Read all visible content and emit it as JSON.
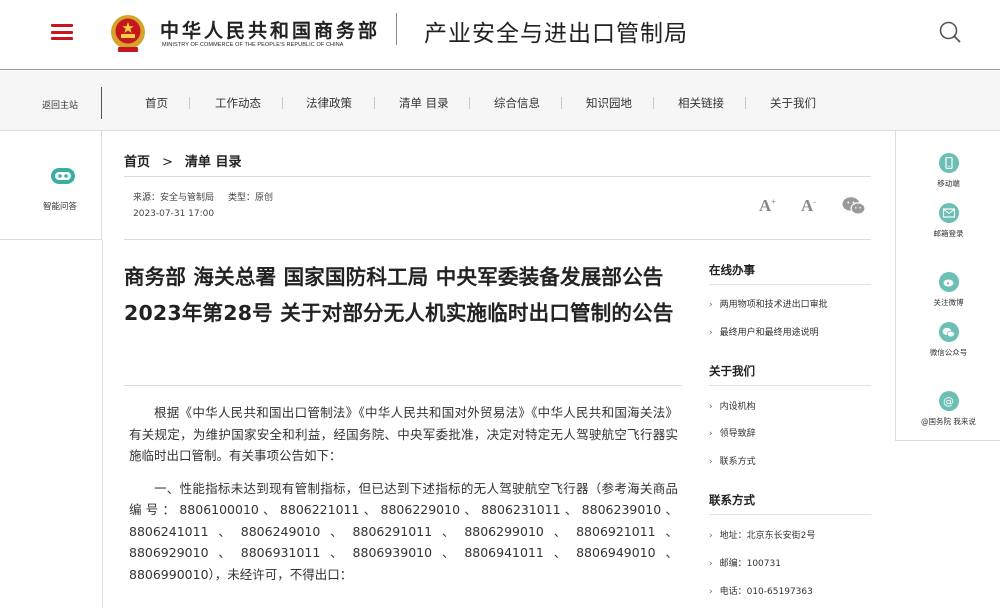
{
  "header": {
    "ministry_cn": "中华人民共和国商务部",
    "ministry_en": "MINISTRY OF COMMERCE OF THE PEOPLE'S REPUBLIC OF CHINA",
    "bureau": "产业安全与进出口管制局",
    "brand_color": "#c8161d"
  },
  "nav": {
    "home": "返回主站",
    "items": [
      "首页",
      "工作动态",
      "法律政策",
      "清单 目录",
      "综合信息",
      "知识园地",
      "相关链接",
      "关于我们"
    ]
  },
  "left_panel": {
    "label": "智能问答",
    "icon": "robot-icon"
  },
  "right_panel": {
    "items": [
      {
        "label": "移动端",
        "icon": "mobile-icon"
      },
      {
        "label": "邮箱登录",
        "icon": "mail-icon"
      },
      {
        "label": "关注微博",
        "icon": "weibo-icon"
      },
      {
        "label": "微信公众号",
        "icon": "wechat-icon"
      },
      {
        "label": "@国务院 我来说",
        "icon": "at-icon"
      }
    ],
    "accent": "#6cbfb4"
  },
  "breadcrumb": {
    "home": "首页",
    "sep": ">",
    "current": "清单 目录"
  },
  "meta": {
    "source_label": "来源：",
    "source": "安全与管制局",
    "type_label": "类型：",
    "type": "原创",
    "date": "2023-07-31 17:00",
    "font_large": "A",
    "font_small": "A",
    "font_large_sup": "+",
    "font_small_sup": "-"
  },
  "article": {
    "title": "商务部 海关总署 国家国防科工局 中央军委装备发展部公告2023年第28号 关于对部分无人机实施临时出口管制的公告",
    "paragraphs": [
      "根据《中华人民共和国出口管制法》《中华人民共和国对外贸易法》《中华人民共和国海关法》有关规定，为维护国家安全和利益，经国务院、中央军委批准，决定对特定无人驾驶航空飞行器实施临时出口管制。有关事项公告如下：",
      "一、性能指标未达到现有管制指标，但已达到下述指标的无人驾驶航空飞行器（参考海关商品编号：8806100010、8806221011、8806229010、8806231011、8806239010、8806241011、8806249010、8806291011、8806299010、8806921011、8806929010、8806931011、8806939010、8806941011、8806949010、8806990010），未经许可，不得出口："
    ]
  },
  "sidebar": {
    "sections": [
      {
        "heading": "在线办事",
        "items": [
          "两用物项和技术进出口审批",
          "最终用户和最终用途说明"
        ]
      },
      {
        "heading": "关于我们",
        "items": [
          "内设机构",
          "领导致辞",
          "联系方式"
        ]
      },
      {
        "heading": "联系方式",
        "items": [
          "地址：北京东长安街2号",
          "邮编：100731",
          "电话：010-65197363"
        ]
      }
    ]
  }
}
